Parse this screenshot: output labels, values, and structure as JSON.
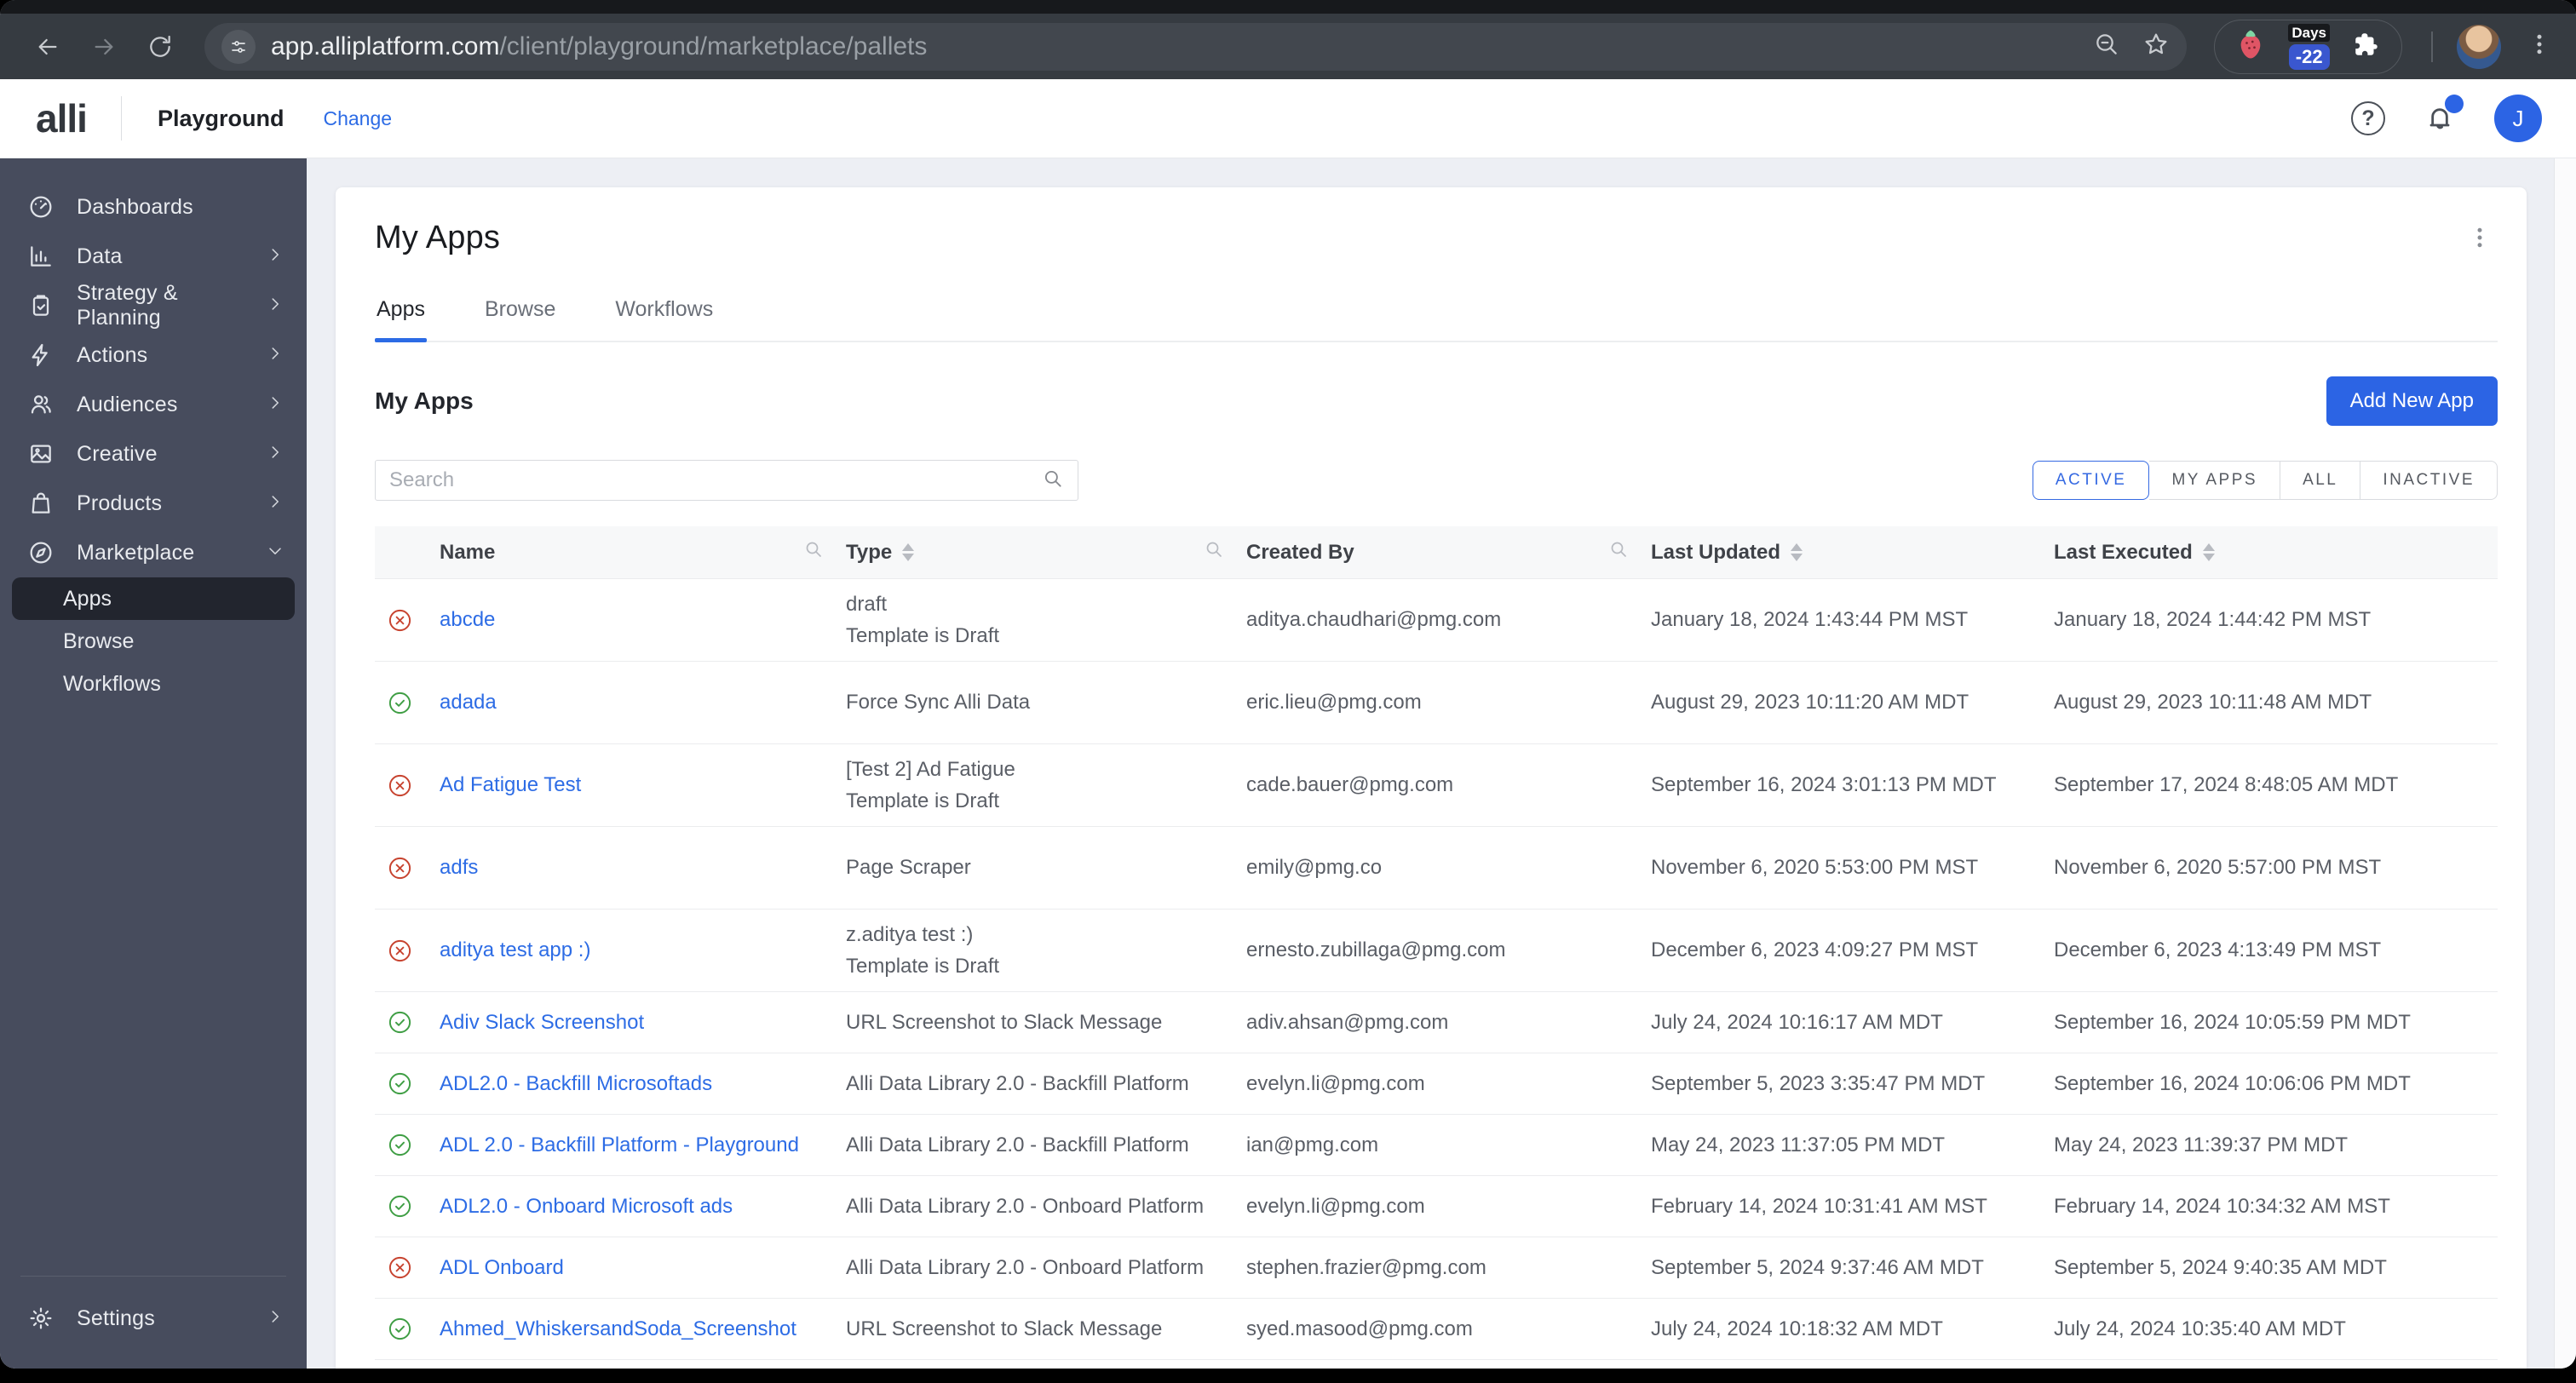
{
  "browser": {
    "url_host": "app.alliplatform.com",
    "url_path": "/client/playground/marketplace/pallets",
    "extension_badge": {
      "top": "Days",
      "value": "-22"
    }
  },
  "header": {
    "logo_text": "alli",
    "client_name": "Playground",
    "change_label": "Change",
    "avatar_initial": "J",
    "notification_dot": true
  },
  "sidebar": {
    "items": [
      {
        "label": "Dashboards",
        "icon": "dashboard",
        "chevron": "none"
      },
      {
        "label": "Data",
        "icon": "bar-chart",
        "chevron": "right"
      },
      {
        "label": "Strategy & Planning",
        "icon": "clipboard",
        "chevron": "right"
      },
      {
        "label": "Actions",
        "icon": "lightning",
        "chevron": "right"
      },
      {
        "label": "Audiences",
        "icon": "people",
        "chevron": "right"
      },
      {
        "label": "Creative",
        "icon": "image",
        "chevron": "right"
      },
      {
        "label": "Products",
        "icon": "shopping-bag",
        "chevron": "right"
      },
      {
        "label": "Marketplace",
        "icon": "compass",
        "chevron": "down",
        "children": [
          {
            "label": "Apps",
            "selected": true
          },
          {
            "label": "Browse",
            "selected": false
          },
          {
            "label": "Workflows",
            "selected": false
          }
        ]
      }
    ],
    "settings": {
      "label": "Settings",
      "icon": "gear",
      "chevron": "right"
    }
  },
  "main": {
    "page_title": "My Apps",
    "tabs": [
      {
        "label": "Apps",
        "active": true
      },
      {
        "label": "Browse",
        "active": false
      },
      {
        "label": "Workflows",
        "active": false
      }
    ],
    "section_title": "My Apps",
    "add_button_label": "Add New App",
    "search_placeholder": "Search",
    "filters": [
      {
        "label": "ACTIVE",
        "selected": true
      },
      {
        "label": "MY APPS",
        "selected": false
      },
      {
        "label": "ALL",
        "selected": false
      },
      {
        "label": "INACTIVE",
        "selected": false
      }
    ],
    "columns": [
      {
        "label": "Name",
        "sortable": false,
        "searchable": true
      },
      {
        "label": "Type",
        "sortable": true,
        "searchable": true
      },
      {
        "label": "Created By",
        "sortable": false,
        "searchable": true
      },
      {
        "label": "Last Updated",
        "sortable": true,
        "searchable": false
      },
      {
        "label": "Last Executed",
        "sortable": true,
        "searchable": false
      }
    ],
    "rows": [
      {
        "status": "inactive",
        "name": "abcde",
        "type_main": "draft",
        "type_sub": "Template is Draft",
        "created_by": "aditya.chaudhari@pmg.com",
        "last_updated": "January 18, 2024 1:43:44 PM MST",
        "last_executed": "January 18, 2024 1:44:42 PM MST"
      },
      {
        "status": "active",
        "name": "adada",
        "type_main": "Force Sync Alli Data",
        "type_sub": "",
        "created_by": "eric.lieu@pmg.com",
        "last_updated": "August 29, 2023 10:11:20 AM MDT",
        "last_executed": "August 29, 2023 10:11:48 AM MDT"
      },
      {
        "status": "inactive",
        "name": "Ad Fatigue Test",
        "type_main": "[Test 2] Ad Fatigue",
        "type_sub": "Template is Draft",
        "created_by": "cade.bauer@pmg.com",
        "last_updated": "September 16, 2024 3:01:13 PM MDT",
        "last_executed": "September 17, 2024 8:48:05 AM MDT"
      },
      {
        "status": "inactive",
        "name": "adfs",
        "type_main": "Page Scraper",
        "type_sub": "",
        "created_by": "emily@pmg.co",
        "last_updated": "November 6, 2020 5:53:00 PM MST",
        "last_executed": "November 6, 2020 5:57:00 PM MST"
      },
      {
        "status": "inactive",
        "name": "aditya test app :)",
        "type_main": "z.aditya test :)",
        "type_sub": "Template is Draft",
        "created_by": "ernesto.zubillaga@pmg.com",
        "last_updated": "December 6, 2023 4:09:27 PM MST",
        "last_executed": "December 6, 2023 4:13:49 PM MST"
      },
      {
        "status": "active",
        "name": "Adiv Slack Screenshot",
        "type_main": "URL Screenshot to Slack Message",
        "type_sub": "",
        "created_by": "adiv.ahsan@pmg.com",
        "last_updated": "July 24, 2024 10:16:17 AM MDT",
        "last_executed": "September 16, 2024 10:05:59 PM MDT"
      },
      {
        "status": "active",
        "name": "ADL2.0 - Backfill Microsoftads",
        "type_main": "Alli Data Library 2.0 - Backfill Platform",
        "type_sub": "",
        "created_by": "evelyn.li@pmg.com",
        "last_updated": "September 5, 2023 3:35:47 PM MDT",
        "last_executed": "September 16, 2024 10:06:06 PM MDT"
      },
      {
        "status": "active",
        "name": "ADL 2.0 - Backfill Platform - Playground",
        "type_main": "Alli Data Library 2.0 - Backfill Platform",
        "type_sub": "",
        "created_by": "ian@pmg.com",
        "last_updated": "May 24, 2023 11:37:05 PM MDT",
        "last_executed": "May 24, 2023 11:39:37 PM MDT"
      },
      {
        "status": "active",
        "name": "ADL2.0 - Onboard Microsoft ads",
        "type_main": "Alli Data Library 2.0 - Onboard Platform",
        "type_sub": "",
        "created_by": "evelyn.li@pmg.com",
        "last_updated": "February 14, 2024 10:31:41 AM MST",
        "last_executed": "February 14, 2024 10:34:32 AM MST"
      },
      {
        "status": "inactive",
        "name": "ADL Onboard",
        "type_main": "Alli Data Library 2.0 - Onboard Platform",
        "type_sub": "",
        "created_by": "stephen.frazier@pmg.com",
        "last_updated": "September 5, 2024 9:37:46 AM MDT",
        "last_executed": "September 5, 2024 9:40:35 AM MDT"
      },
      {
        "status": "active",
        "name": "Ahmed_WhiskersandSoda_Screenshot",
        "type_main": "URL Screenshot to Slack Message",
        "type_sub": "",
        "created_by": "syed.masood@pmg.com",
        "last_updated": "July 24, 2024 10:18:32 AM MDT",
        "last_executed": "July 24, 2024 10:35:40 AM MDT"
      }
    ]
  }
}
